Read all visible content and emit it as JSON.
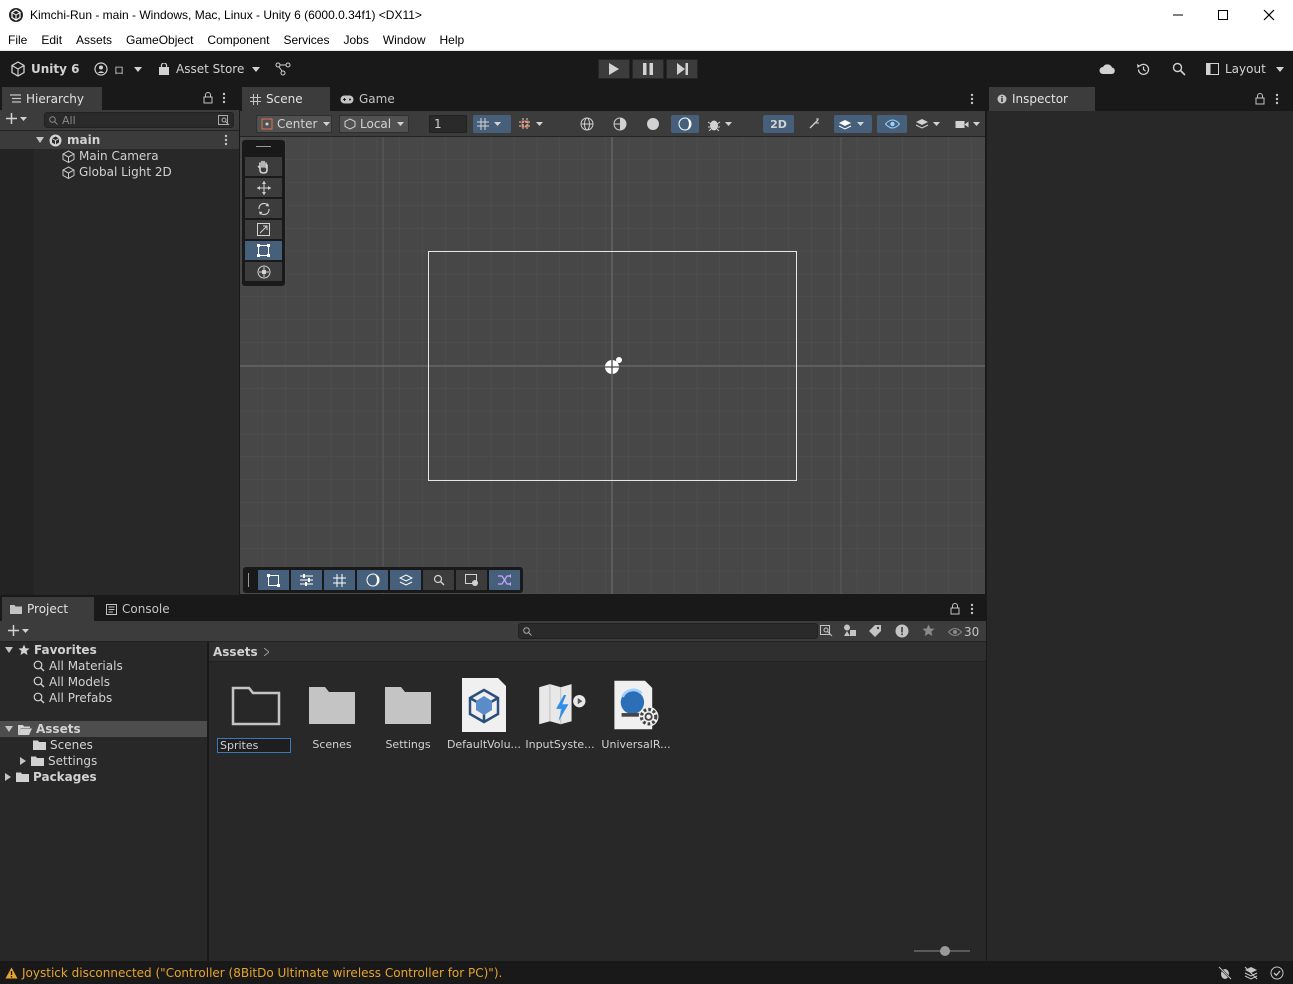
{
  "window": {
    "title": "Kimchi-Run - main - Windows, Mac, Linux - Unity 6 (6000.0.34f1) <DX11>"
  },
  "menu": [
    "File",
    "Edit",
    "Assets",
    "GameObject",
    "Component",
    "Services",
    "Jobs",
    "Window",
    "Help"
  ],
  "toolbar": {
    "unity_label": "Unity 6",
    "account_label": "ロ",
    "asset_store_label": "Asset Store",
    "layout_label": "Layout"
  },
  "hierarchy": {
    "tab_label": "Hierarchy",
    "search_placeholder": "All",
    "scene_name": "main",
    "items": [
      "Main Camera",
      "Global Light 2D"
    ]
  },
  "scene": {
    "tabs": [
      "Scene",
      "Game"
    ],
    "pivot_mode": "Center",
    "pivot_rotation": "Local",
    "snap_value": "1",
    "mode_2d_label": "2D"
  },
  "inspector": {
    "tab_label": "Inspector"
  },
  "project": {
    "tabs": [
      "Project",
      "Console"
    ],
    "visible_count": "30",
    "breadcrumb": "Assets",
    "favorites_label": "Favorites",
    "favorites": [
      "All Materials",
      "All Models",
      "All Prefabs"
    ],
    "assets_label": "Assets",
    "asset_folders": [
      "Scenes",
      "Settings"
    ],
    "packages_label": "Packages",
    "assets": [
      {
        "label": "Sprites",
        "kind": "folder-empty-renaming"
      },
      {
        "label": "Scenes",
        "kind": "folder"
      },
      {
        "label": "Settings",
        "kind": "folder"
      },
      {
        "label": "DefaultVolu...",
        "kind": "volume-profile"
      },
      {
        "label": "InputSyste...",
        "kind": "input-actions"
      },
      {
        "label": "UniversalR...",
        "kind": "render-pipeline-settings"
      }
    ]
  },
  "status": {
    "message": "Joystick disconnected (\"Controller (8BitDo Ultimate wireless Controller for PC)\")."
  },
  "colors": {
    "accent_blue": "#46607c",
    "warning": "#e6a42c",
    "panel_bg": "#282828",
    "scene_bg": "#474747"
  }
}
